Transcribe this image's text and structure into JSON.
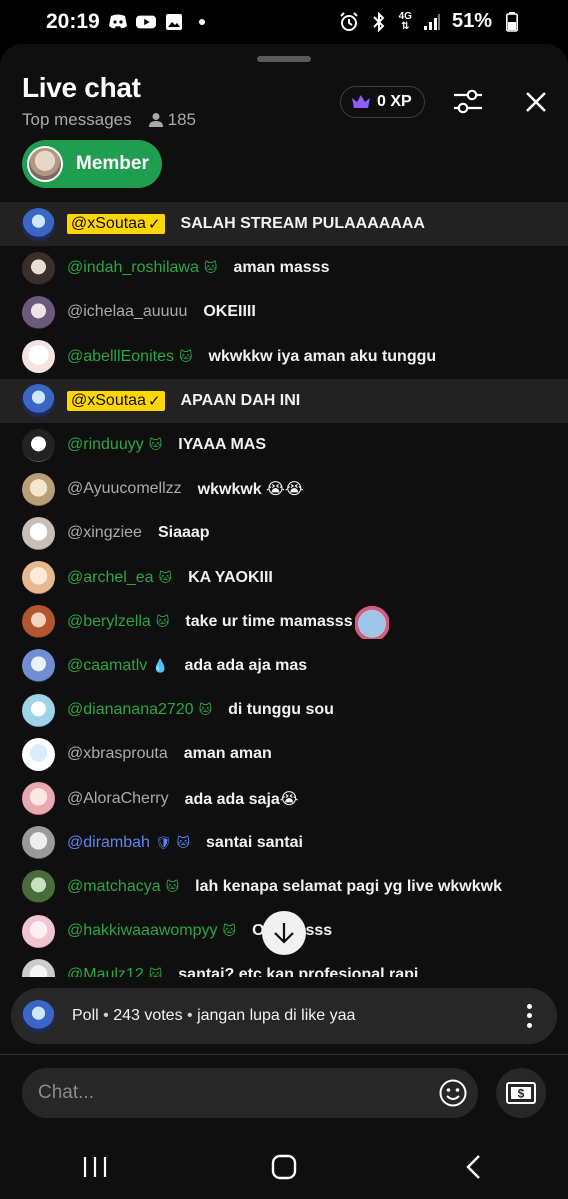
{
  "status_bar": {
    "time": "20:19",
    "battery": "51%",
    "network": "4G"
  },
  "header": {
    "title": "Live chat",
    "mode": "Top messages",
    "viewer_count": "185",
    "xp_label": "0 XP",
    "member_chip_label": "Member"
  },
  "colors": {
    "member_green": "#2ba640",
    "owner_yellow": "#ffd600",
    "moderator_blue": "#5e84f1",
    "chip_green": "#1f9e4f"
  },
  "messages": [
    {
      "author": "@xSoutaa",
      "role": "owner",
      "text": "SALAH STREAM PULAAAAAAA"
    },
    {
      "author": "@indah_roshilawa",
      "role": "member",
      "text": "aman masss"
    },
    {
      "author": "@ichelaa_auuuu",
      "role": "plain",
      "text": "OKEIIII"
    },
    {
      "author": "@abelllEonites",
      "role": "member",
      "text": "wkwkkw iya aman aku tunggu"
    },
    {
      "author": "@xSoutaa",
      "role": "owner",
      "text": "APAAN DAH INI"
    },
    {
      "author": "@rinduuyy",
      "role": "member",
      "text": "IYAAA MAS"
    },
    {
      "author": "@Ayuucomellzz",
      "role": "plain",
      "text": "wkwkwk 😭😭"
    },
    {
      "author": "@xingziee",
      "role": "plain",
      "text": "Siaaap"
    },
    {
      "author": "@archel_ea",
      "role": "member",
      "text": "KA YAOKIII"
    },
    {
      "author": "@berylzella",
      "role": "member",
      "text": "take ur time mamasss"
    },
    {
      "author": "@caamatlv",
      "role": "member",
      "text": "ada ada aja mas"
    },
    {
      "author": "@diananana2720",
      "role": "member",
      "text": "di tunggu sou"
    },
    {
      "author": "@xbrasprouta",
      "role": "plain",
      "text": "aman aman"
    },
    {
      "author": "@AloraCherry",
      "role": "plain",
      "text": "ada ada saja😭"
    },
    {
      "author": "@dirambah",
      "role": "mod",
      "text": "santai santai"
    },
    {
      "author": "@matchacya",
      "role": "member",
      "text": "lah kenapa selamat pagi yg live wkwkwk"
    },
    {
      "author": "@hakkiwaaawompyy",
      "role": "member",
      "text": "Okemasss"
    },
    {
      "author": "@Maulz12",
      "role": "member",
      "text": "santai? etc kan profesional rapi"
    }
  ],
  "poll": {
    "label": "Poll",
    "votes": "243 votes",
    "question": "jangan lupa di like yaa"
  },
  "input": {
    "placeholder": "Chat..."
  },
  "icons": {
    "xp": "crown-icon",
    "tune": "tune-icon",
    "close": "close-icon",
    "scroll": "arrow-down-icon",
    "emoji": "emoji-icon",
    "super_chat": "dollar-icon"
  }
}
